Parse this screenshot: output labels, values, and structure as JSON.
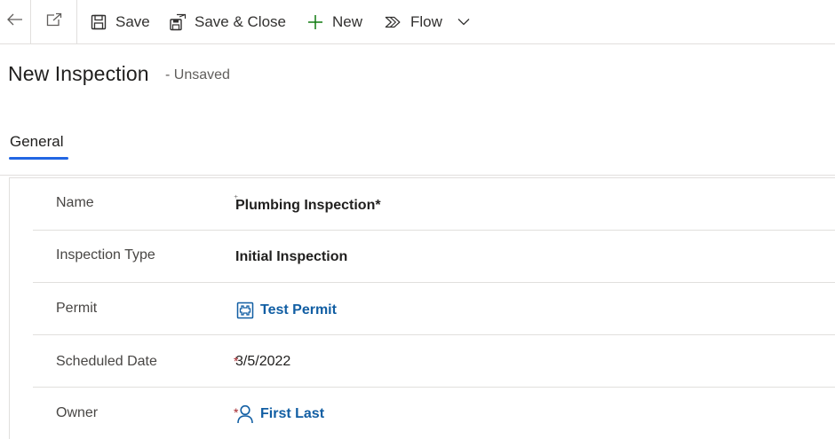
{
  "commandbar": {
    "back_icon": "back-arrow-icon",
    "popout_icon": "popout-icon",
    "save_label": "Save",
    "save_close_label": "Save & Close",
    "new_label": "New",
    "flow_label": "Flow",
    "accent_green": "#107c10"
  },
  "header": {
    "title": "New Inspection",
    "status": "- Unsaved"
  },
  "tabs": {
    "active": "General",
    "accent": "#2266e3"
  },
  "form": {
    "name": {
      "label": "Name",
      "required_marker": "⁺",
      "value": "Plumbing Inspection*"
    },
    "inspection_type": {
      "label": "Inspection Type",
      "value": "Initial Inspection"
    },
    "permit": {
      "label": "Permit",
      "value": "Test Permit",
      "icon": "entity-record-icon"
    },
    "scheduled_date": {
      "label": "Scheduled Date",
      "required_marker": "*",
      "value": "3/5/2022"
    },
    "owner": {
      "label": "Owner",
      "required_marker": "*",
      "value": "First Last",
      "icon": "person-icon"
    }
  }
}
